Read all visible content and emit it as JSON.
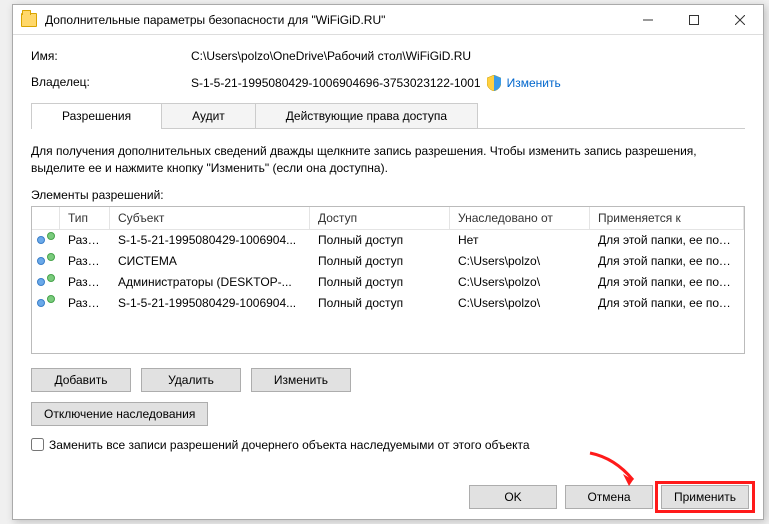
{
  "window": {
    "title": "Дополнительные параметры безопасности для \"WiFiGiD.RU\""
  },
  "fields": {
    "name_label": "Имя:",
    "name_value": "C:\\Users\\polzo\\OneDrive\\Рабочий стол\\WiFiGiD.RU",
    "owner_label": "Владелец:",
    "owner_value": "S-1-5-21-1995080429-1006904696-3753023122-1001",
    "owner_change": "Изменить"
  },
  "tabs": {
    "t0": "Разрешения",
    "t1": "Аудит",
    "t2": "Действующие права доступа"
  },
  "description": "Для получения дополнительных сведений дважды щелкните запись разрешения. Чтобы изменить запись разрешения, выделите ее и нажмите кнопку \"Изменить\" (если она доступна).",
  "list_label": "Элементы разрешений:",
  "columns": {
    "type": "Тип",
    "subject": "Субъект",
    "access": "Доступ",
    "inherited": "Унаследовано от",
    "applies": "Применяется к"
  },
  "rows": {
    "r0": {
      "type": "Разр...",
      "subject": "S-1-5-21-1995080429-1006904...",
      "access": "Полный доступ",
      "inherited": "Нет",
      "applies": "Для этой папки, ее подпапок ..."
    },
    "r1": {
      "type": "Разр...",
      "subject": "СИСТЕМА",
      "access": "Полный доступ",
      "inherited": "C:\\Users\\polzo\\",
      "applies": "Для этой папки, ее подпапок ..."
    },
    "r2": {
      "type": "Разр...",
      "subject": "Администраторы (DESKTOP-...",
      "access": "Полный доступ",
      "inherited": "C:\\Users\\polzo\\",
      "applies": "Для этой папки, ее подпапок ..."
    },
    "r3": {
      "type": "Разр...",
      "subject": "S-1-5-21-1995080429-1006904...",
      "access": "Полный доступ",
      "inherited": "C:\\Users\\polzo\\",
      "applies": "Для этой папки, ее подпапок ..."
    }
  },
  "buttons": {
    "add": "Добавить",
    "remove": "Удалить",
    "edit": "Изменить",
    "disable_inh": "Отключение наследования",
    "ok": "OK",
    "cancel": "Отмена",
    "apply": "Применить"
  },
  "checkbox_label": "Заменить все записи разрешений дочернего объекта наследуемыми от этого объекта"
}
